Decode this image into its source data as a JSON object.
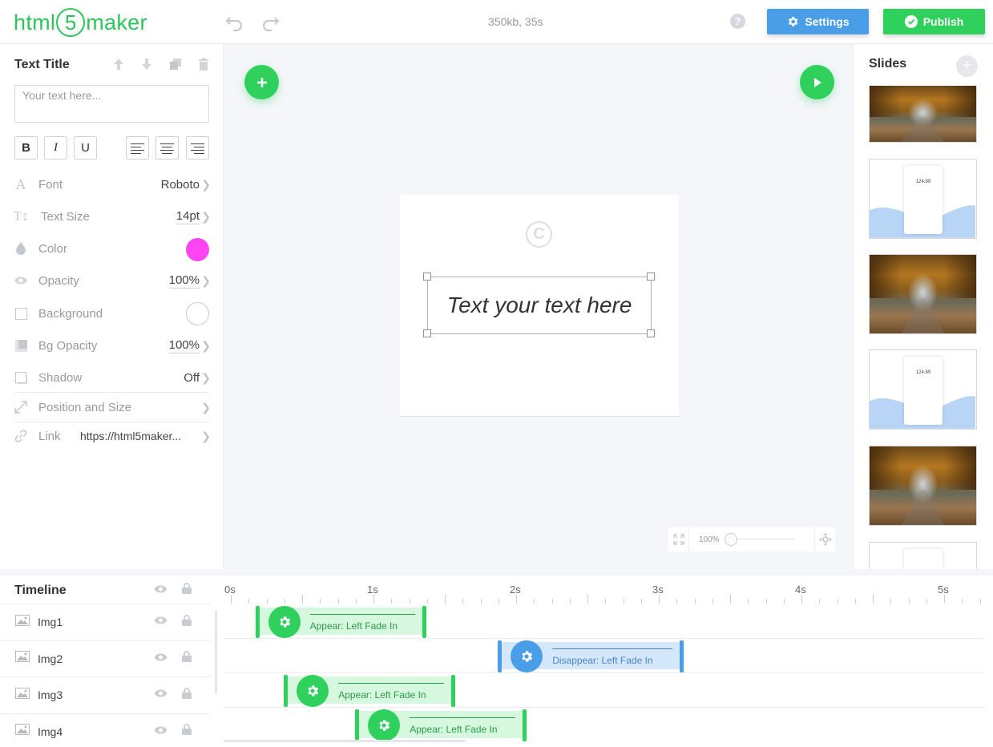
{
  "header": {
    "logo_left": "html",
    "logo_mid": "5",
    "logo_right": "maker",
    "file_info": "350kb, 35s",
    "help_label": "?",
    "settings_label": "Settings",
    "publish_label": "Publish"
  },
  "left_panel": {
    "title": "Text Title",
    "text_placeholder": "Your text here...",
    "format_buttons": [
      "B",
      "I",
      "U"
    ],
    "properties": {
      "font": {
        "label": "Font",
        "value": "Roboto"
      },
      "text_size": {
        "label": "Text Size",
        "value": "14pt"
      },
      "color": {
        "label": "Color",
        "value": "#ff44f4"
      },
      "opacity": {
        "label": "Opacity",
        "value": "100%"
      },
      "background": {
        "label": "Background",
        "value": "#ffffff"
      },
      "bg_opacity": {
        "label": "Bg Opacity",
        "value": "100%"
      },
      "shadow": {
        "label": "Shadow",
        "value": "Off"
      },
      "position_size": {
        "label": "Position and Size"
      },
      "link": {
        "label": "Link",
        "value": "https://html5maker..."
      }
    }
  },
  "canvas": {
    "watermark": "C",
    "text": "Text your text here",
    "zoom": "100%",
    "zoom_level": 0
  },
  "slides": {
    "title": "Slides",
    "add_label": "+",
    "items": [
      {
        "type": "forest-photo"
      },
      {
        "type": "app-screen",
        "price": "124.89"
      },
      {
        "type": "forest-photo"
      },
      {
        "type": "app-screen",
        "price": "124.89"
      },
      {
        "type": "forest-photo"
      },
      {
        "type": "app-screen"
      }
    ]
  },
  "timeline": {
    "title": "Timeline",
    "ruler": [
      "0s",
      "1s",
      "2s",
      "3s",
      "4s",
      "5s"
    ],
    "layers": [
      {
        "name": "Img1",
        "animation": "Appear: Left Fade In",
        "kind": "appear",
        "start_s": 0.2,
        "end_s": 1.4
      },
      {
        "name": "Img2",
        "animation": "Disappear: Left Fade In",
        "kind": "disappear",
        "start_s": 1.9,
        "end_s": 3.2
      },
      {
        "name": "Img3",
        "animation": "Appear: Left Fade In",
        "kind": "appear",
        "start_s": 0.4,
        "end_s": 1.6
      },
      {
        "name": "Img4",
        "animation": "Appear: Left Fade In",
        "kind": "appear",
        "start_s": 0.9,
        "end_s": 2.1
      }
    ]
  },
  "colors": {
    "brand_green": "#2fd15c",
    "brand_blue": "#4a9ee8",
    "text_color_swatch": "#ff44f4"
  }
}
